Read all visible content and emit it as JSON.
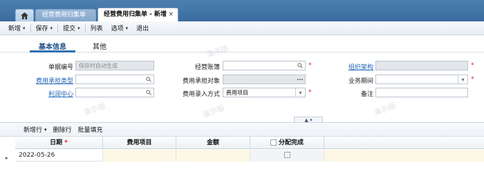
{
  "tabs": {
    "home_icon": "home-icon",
    "items": [
      {
        "label": "经营费用归集单"
      },
      {
        "label": "经营费用归集单 - 新增",
        "close": "×"
      }
    ]
  },
  "toolbar": {
    "items": [
      {
        "label": "新增",
        "caret": "▾"
      },
      {
        "label": "保存",
        "caret": "▾"
      },
      {
        "label": "提交",
        "caret": "▾"
      },
      {
        "label": "列表"
      },
      {
        "label": "选项",
        "caret": "▾"
      },
      {
        "label": "退出"
      }
    ]
  },
  "subtabs": {
    "basic": "基本信息",
    "other": "其他"
  },
  "form": {
    "doc_no": {
      "label": "单据编号",
      "placeholder": "保存时自动生成"
    },
    "bearer_type": {
      "label": "费用承担类型"
    },
    "profit_center": {
      "label": "利润中心"
    },
    "account": {
      "label": "经营账簿"
    },
    "bearer_object": {
      "label": "费用承担对象",
      "button": "···"
    },
    "entry_mode": {
      "label": "费用录入方式",
      "value": "费用项目"
    },
    "org": {
      "label": "组织架构"
    },
    "period": {
      "label": "业务期间"
    },
    "remark": {
      "label": "备注"
    }
  },
  "required_mark": "*",
  "collapse_label": "▲ ▾",
  "grid_toolbar": {
    "add_row": "新增行",
    "delete_row": "删除行",
    "batch_fill": "批量填充"
  },
  "grid": {
    "columns": [
      "日期",
      "费用项目",
      "金额",
      "分配完成"
    ],
    "rows": [
      {
        "date": "2022-05-26",
        "item": "",
        "amount": ""
      }
    ]
  },
  "watermark": "演示版",
  "colors": {
    "tab_bar": "#3a6b9f",
    "link": "#2366b8",
    "required": "#d02020",
    "active_tab": "#2f6fb2",
    "editable_cell": "#fdf8e6"
  }
}
